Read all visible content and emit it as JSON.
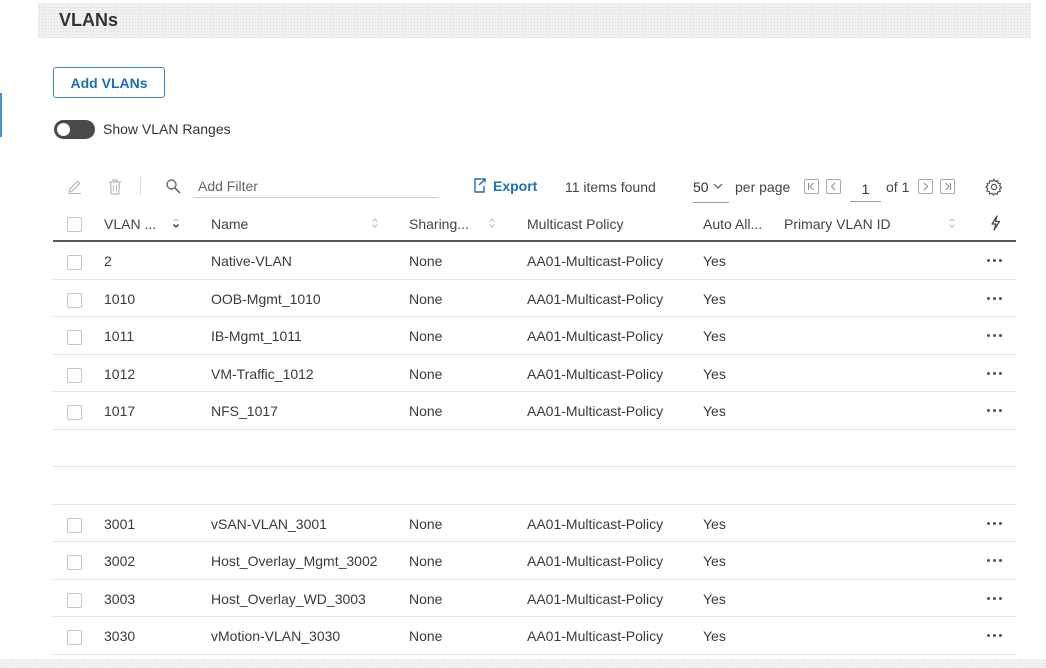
{
  "page": {
    "title": "VLANs"
  },
  "actions": {
    "add_label": "Add VLANs"
  },
  "toggle": {
    "label": "Show VLAN Ranges",
    "on": false
  },
  "toolbar": {
    "edit_icon": "pencil-icon",
    "delete_icon": "trash-icon",
    "search_icon": "search-icon",
    "filter_placeholder": "Add Filter",
    "export_label": "Export",
    "items_found": "11 items found",
    "per_page_value": "50",
    "per_page_label": "per page",
    "current_page": "1",
    "of_label": "of 1"
  },
  "columns": {
    "vlan": "VLAN ...",
    "name": "Name",
    "sharing": "Sharing...",
    "multicast": "Multicast Policy",
    "auto": "Auto All...",
    "primary": "Primary VLAN ID"
  },
  "rows": [
    {
      "vlan": "2",
      "name": "Native-VLAN",
      "sharing": "None",
      "multicast": "AA01-Multicast-Policy",
      "auto": "Yes",
      "primary": ""
    },
    {
      "vlan": "1010",
      "name": "OOB-Mgmt_1010",
      "sharing": "None",
      "multicast": "AA01-Multicast-Policy",
      "auto": "Yes",
      "primary": ""
    },
    {
      "vlan": "1011",
      "name": "IB-Mgmt_1011",
      "sharing": "None",
      "multicast": "AA01-Multicast-Policy",
      "auto": "Yes",
      "primary": ""
    },
    {
      "vlan": "1012",
      "name": "VM-Traffic_1012",
      "sharing": "None",
      "multicast": "AA01-Multicast-Policy",
      "auto": "Yes",
      "primary": ""
    },
    {
      "vlan": "1017",
      "name": "NFS_1017",
      "sharing": "None",
      "multicast": "AA01-Multicast-Policy",
      "auto": "Yes",
      "primary": ""
    },
    {
      "vlan": "",
      "name": "",
      "sharing": "",
      "multicast": "",
      "auto": "",
      "primary": ""
    },
    {
      "vlan": "",
      "name": "",
      "sharing": "",
      "multicast": "",
      "auto": "",
      "primary": ""
    },
    {
      "vlan": "3001",
      "name": "vSAN-VLAN_3001",
      "sharing": "None",
      "multicast": "AA01-Multicast-Policy",
      "auto": "Yes",
      "primary": ""
    },
    {
      "vlan": "3002",
      "name": "Host_Overlay_Mgmt_3002",
      "sharing": "None",
      "multicast": "AA01-Multicast-Policy",
      "auto": "Yes",
      "primary": ""
    },
    {
      "vlan": "3003",
      "name": "Host_Overlay_WD_3003",
      "sharing": "None",
      "multicast": "AA01-Multicast-Policy",
      "auto": "Yes",
      "primary": ""
    },
    {
      "vlan": "3030",
      "name": "vMotion-VLAN_3030",
      "sharing": "None",
      "multicast": "AA01-Multicast-Policy",
      "auto": "Yes",
      "primary": ""
    }
  ],
  "colors": {
    "accent": "#1f6fb8",
    "toggle_off": "#4a4a4a",
    "header_rule": "#5a5a5a"
  }
}
